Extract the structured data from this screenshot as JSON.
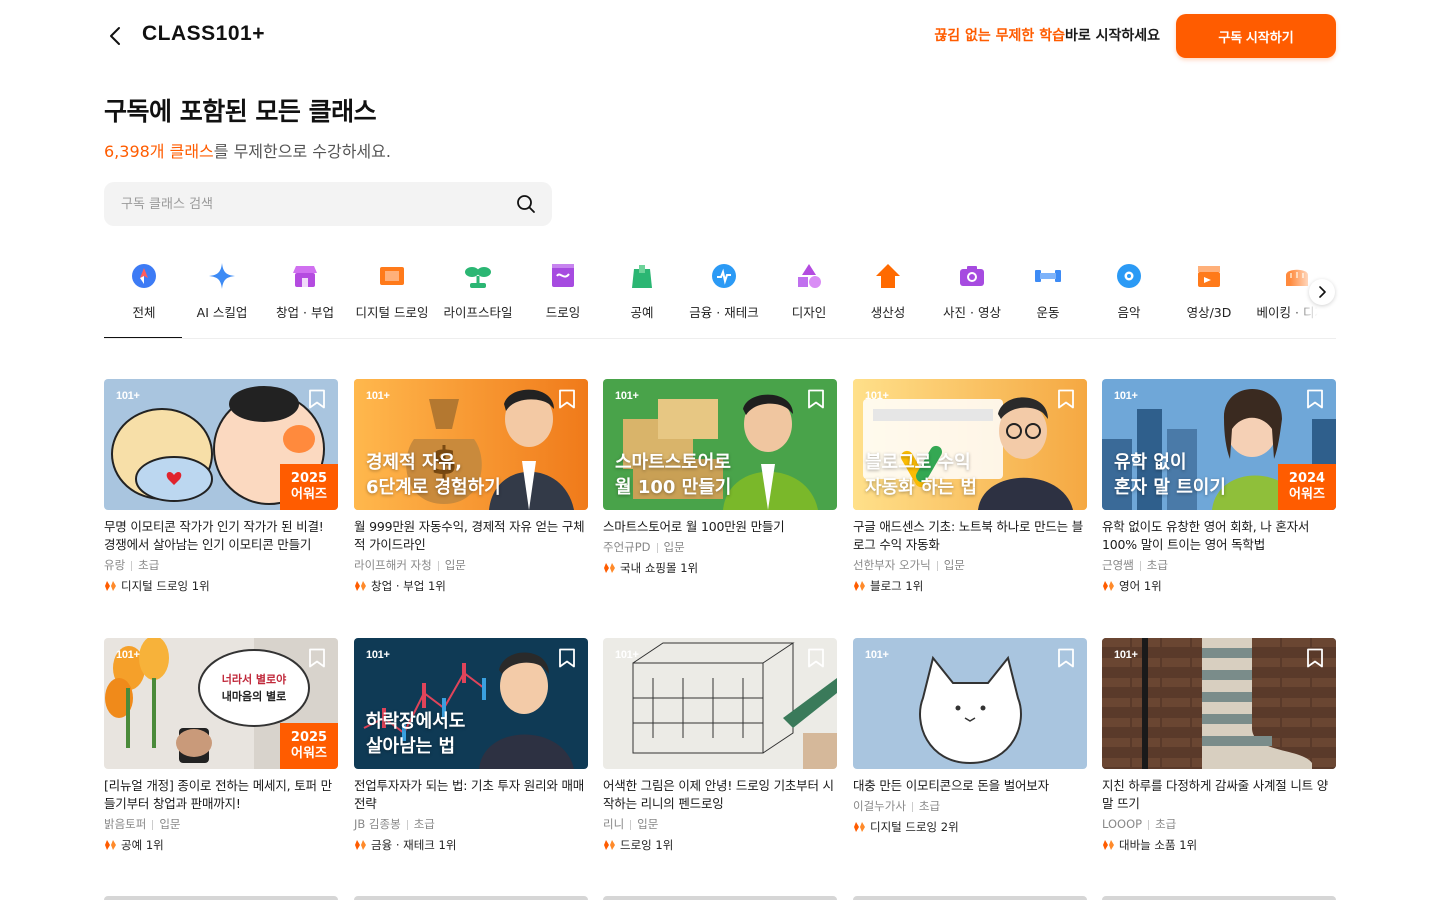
{
  "header": {
    "logo": "CLASS101+",
    "promo_highlight": "끊김 없는 무제한 학습",
    "promo_rest": "바로 시작하세요",
    "cta_label": "구독 시작하기"
  },
  "page": {
    "title": "구독에 포함된 모든 클래스",
    "count_highlight": "6,398개 클래스",
    "count_rest": "를 무제한으로 수강하세요."
  },
  "search": {
    "placeholder": "구독 클래스 검색",
    "value": ""
  },
  "categories": [
    {
      "label": "전체",
      "icon": "compass-icon",
      "color": "#3d7bf5",
      "selected": true
    },
    {
      "label": "AI 스킬업",
      "icon": "sparkle-icon",
      "color": "#3d8bf5"
    },
    {
      "label": "창업 · 부업",
      "icon": "shop-icon",
      "color": "#b44be0"
    },
    {
      "label": "디지털 드로잉",
      "icon": "film-frame-icon",
      "color": "#ff7a1a"
    },
    {
      "label": "라이프스타일",
      "icon": "sprout-icon",
      "color": "#2bb673"
    },
    {
      "label": "드로잉",
      "icon": "sketchbook-icon",
      "color": "#a64be0"
    },
    {
      "label": "공예",
      "icon": "craft-bag-icon",
      "color": "#2bb673"
    },
    {
      "label": "금융 · 재테크",
      "icon": "coin-chart-icon",
      "color": "#2b9af5"
    },
    {
      "label": "디자인",
      "icon": "shapes-icon",
      "color": "#b44be0"
    },
    {
      "label": "생산성",
      "icon": "house-arrow-icon",
      "color": "#ff6a00"
    },
    {
      "label": "사진 · 영상",
      "icon": "camera-icon",
      "color": "#a64be0"
    },
    {
      "label": "운동",
      "icon": "dumbbell-icon",
      "color": "#3d8bf5"
    },
    {
      "label": "음악",
      "icon": "disc-icon",
      "color": "#2b9af5"
    },
    {
      "label": "영상/3D",
      "icon": "clapper-icon",
      "color": "#ff7a1a"
    },
    {
      "label": "베이킹 · 디저트",
      "icon": "bread-icon",
      "color": "#ff8a3d"
    }
  ],
  "classes": [
    {
      "title": "무명 이모티콘 작가가 인기 작가가 된 비결! 경쟁에서 살아남는 인기 이모티콘 만들기",
      "creator": "유랑",
      "level": "초급",
      "rank": "디지털 드로잉 1위",
      "thumb_text": "",
      "award": "2025\n어워즈",
      "thumb_icon": "bear-character-icon"
    },
    {
      "title": "월 999만원 자동수익, 경제적 자유 얻는 구체적 가이드라인",
      "creator": "라이프해커 자청",
      "level": "입문",
      "rank": "창업 · 부업 1위",
      "thumb_text": "경제적 자유,\n6단계로 경험하기",
      "award": "",
      "thumb_icon": "money-bag-icon"
    },
    {
      "title": "스마트스토어로 월 100만원 만들기",
      "creator": "주언규PD",
      "level": "입문",
      "rank": "국내 쇼핑몰 1위",
      "thumb_text": "스마트스토어로\n월 100 만들기",
      "award": "",
      "thumb_icon": "boxes-icon"
    },
    {
      "title": "구글 애드센스 기초: 노트북 하나로 만드는 블로그 수익 자동화",
      "creator": "선한부자 오가닉",
      "level": "입문",
      "rank": "블로그 1위",
      "thumb_text": "블로그로 수익\n자동화 하는 법",
      "award": "",
      "thumb_icon": "laptop-icon"
    },
    {
      "title": "유학 없이도 유창한 영어 회화, 나 혼자서 100% 말이 트이는 영어 독학법",
      "creator": "근영쌤",
      "level": "초급",
      "rank": "영어 1위",
      "thumb_text": "유학 없이\n혼자 말 트이기",
      "award": "2024\n어워즈",
      "thumb_icon": "city-icon"
    },
    {
      "title": "[리뉴얼 개정] 종이로 전하는 메세지, 토퍼 만들기부터 창업과 판매까지!",
      "creator": "밝음토퍼",
      "level": "입문",
      "rank": "공예 1위",
      "thumb_text": "",
      "award": "2025\n어워즈",
      "thumb_icon": "tulip-icon"
    },
    {
      "title": "전업투자자가 되는 법: 기초 투자 원리와 매매 전략",
      "creator": "JB 김종봉",
      "level": "초급",
      "rank": "금융 · 재테크 1위",
      "thumb_text": "하락장에서도\n살아남는 법",
      "award": "",
      "thumb_icon": "candlestick-icon"
    },
    {
      "title": "어색한 그림은 이제 안녕! 드로잉 기초부터 시작하는 리니의 펜드로잉",
      "creator": "리니",
      "level": "입문",
      "rank": "드로잉 1위",
      "thumb_text": "",
      "award": "",
      "thumb_icon": "sketch-icon"
    },
    {
      "title": "대충 만든 이모티콘으로 돈을 벌어보자",
      "creator": "이걸누가사",
      "level": "초급",
      "rank": "디지털 드로잉 2위",
      "thumb_text": "",
      "award": "",
      "thumb_icon": "cat-character-icon"
    },
    {
      "title": "지친 하루를 다정하게 감싸줄 사계절 니트 양말 뜨기",
      "creator": "LOOOP",
      "level": "초급",
      "rank": "대바늘 소품 1위",
      "thumb_text": "",
      "award": "",
      "thumb_icon": "sock-icon"
    }
  ],
  "colors": {
    "accent": "#ff5c00",
    "text": "#1a1a1a",
    "muted": "#888888"
  }
}
